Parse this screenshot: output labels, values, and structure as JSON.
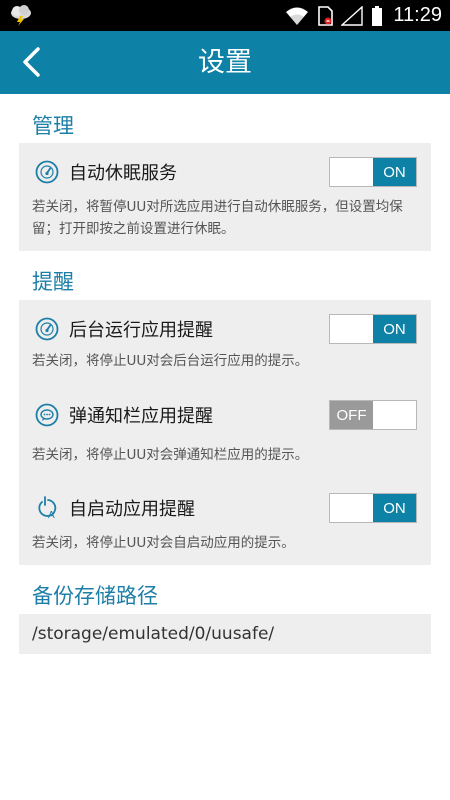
{
  "status_bar": {
    "time": "11:29"
  },
  "header": {
    "title": "设置"
  },
  "sections": {
    "manage": {
      "title": "管理"
    },
    "remind": {
      "title": "提醒"
    },
    "backup": {
      "title": "备份存储路径"
    }
  },
  "settings": {
    "auto_sleep": {
      "label": "自动休眠服务",
      "desc": "若关闭，将暂停UU对所选应用进行自动休眠服务，但设置均保留；打开即按之前设置进行休眠。",
      "state": "ON"
    },
    "bg_run": {
      "label": "后台运行应用提醒",
      "desc": "若关闭，将停止UU对会后台运行应用的提示。",
      "state": "ON"
    },
    "notify_bar": {
      "label": "弹通知栏应用提醒",
      "desc": "若关闭，将停止UU对会弹通知栏应用的提示。",
      "state": "OFF"
    },
    "auto_start": {
      "label": "自启动应用提醒",
      "desc": "若关闭，将停止UU对会自启动应用的提示。",
      "state": "ON"
    }
  },
  "backup_path": "/storage/emulated/0/uusafe/",
  "colors": {
    "accent": "#0d81a6",
    "section_title": "#1d7fa7",
    "card_bg": "#eeeeee",
    "off": "#9a9a9a"
  }
}
